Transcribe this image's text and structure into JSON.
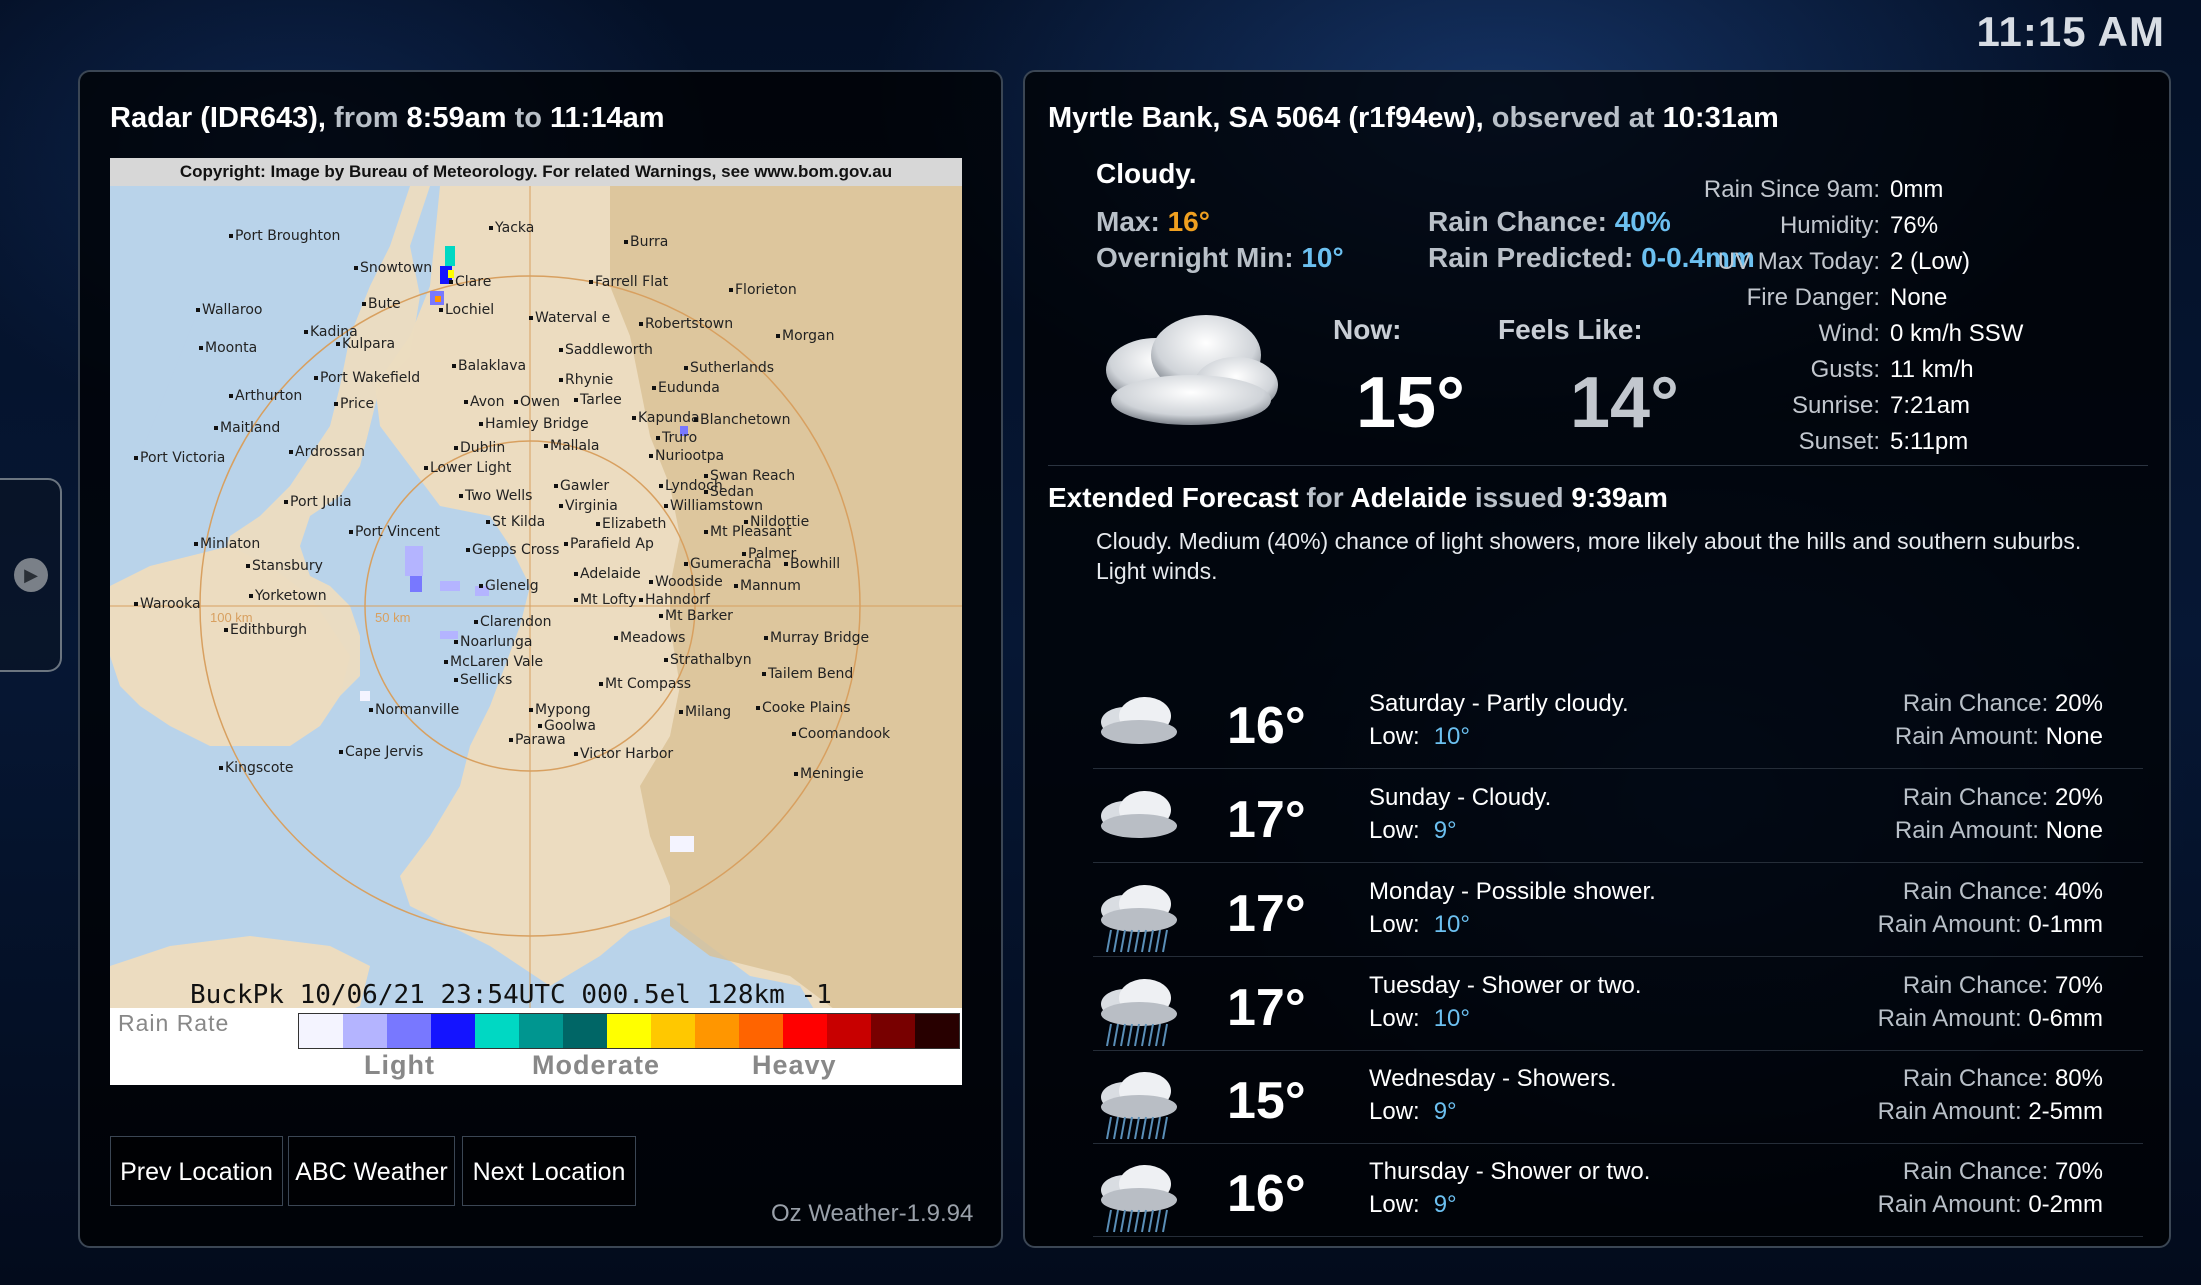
{
  "clock": "11:15 AM",
  "radar_panel": {
    "title_prefix": "Radar (IDR643),",
    "title_from": "from",
    "title_start": "8:59am",
    "title_to": "to",
    "title_end": "11:14am",
    "copyright": "Copyright: Image by Bureau of Meteorology. For related Warnings, see www.bom.gov.au",
    "info_line": "BuckPk  10/06/21 23:54UTC 000.5el 128km -1",
    "legend_title": "Rain Rate",
    "legend_light": "Light",
    "legend_moderate": "Moderate",
    "legend_heavy": "Heavy",
    "ring_labels": [
      "100 km",
      "50 km"
    ],
    "legend_colors": [
      "#f4f4ff",
      "#b4b4ff",
      "#7878ff",
      "#1414ff",
      "#00d8c3",
      "#009690",
      "#006666",
      "#ffff00",
      "#ffc800",
      "#ff9600",
      "#ff6400",
      "#ff0000",
      "#c80000",
      "#780000",
      "#280000"
    ],
    "towns": [
      "Port Broughton",
      "Yacka",
      "Burra",
      "Snowtown",
      "Clare",
      "Farrell Flat",
      "Florieton",
      "Bute",
      "Lochiel",
      "Wallaroo",
      "Kadina",
      "Waterval e",
      "Robertstown",
      "Morgan",
      "Moonta",
      "Kulpara",
      "Saddleworth",
      "Balaklava",
      "Sutherlands",
      "Port Wakefield",
      "Rhynie",
      "Eudunda",
      "Arthurton",
      "Price",
      "Avon",
      "Owen",
      "Tarlee",
      "Maitland",
      "Hamley Bridge",
      "Kapunda",
      "Blanchetown",
      "Dublin",
      "Mallala",
      "Truro",
      "Port Victoria",
      "Ardrossan",
      "Nuriootpa",
      "Lower Light",
      "Swan Reach",
      "Two Wells",
      "Gawler",
      "Lyndoch",
      "Sedan",
      "Port Julia",
      "Virginia",
      "Williamstown",
      "Nildottie",
      "St Kilda",
      "Elizabeth",
      "Mt Pleasant",
      "Minlaton",
      "Port Vincent",
      "Parafield Ap",
      "Palmer",
      "Stansbury",
      "Gepps Cross",
      "Gumeracha",
      "Bowhill",
      "Glenelg",
      "Adelaide",
      "Woodside",
      "Mannum",
      "Yorketown",
      "Mt Lofty",
      "Hahndorf",
      "Warooka",
      "Mt Barker",
      "Edithburgh",
      "Clarendon",
      "Meadows",
      "Murray Bridge",
      "Noarlunga",
      "Strathalbyn",
      "McLaren Vale",
      "Tailem Bend",
      "Sellicks",
      "Mt Compass",
      "Normanville",
      "Mypong",
      "Milang",
      "Cooke Plains",
      "Goolwa",
      "Coomandook",
      "Parawa",
      "Cape Jervis",
      "Victor Harbor",
      "Kingscote",
      "Meningie"
    ],
    "buttons": [
      "Prev Location",
      "ABC Weather",
      "Next Location"
    ],
    "version": "Oz Weather-1.9.94"
  },
  "obs_panel": {
    "location": "Myrtle Bank, SA 5064 (r1f94ew),",
    "observed_label": "observed at",
    "observed_time": "10:31am",
    "condition": "Cloudy.",
    "max_label": "Max:",
    "max_value": "16°",
    "min_label": "Overnight Min:",
    "min_value": "10°",
    "rain_chance_label": "Rain Chance:",
    "rain_chance_value": "40%",
    "rain_pred_label": "Rain Predicted:",
    "rain_pred_value": "0-0.4mm",
    "now_label": "Now:",
    "now_temp": "15°",
    "feels_label": "Feels Like:",
    "feels_temp": "14°",
    "details": [
      {
        "k": "Rain Since 9am:",
        "v": "0mm"
      },
      {
        "k": "Humidity:",
        "v": "76%"
      },
      {
        "k": "UV Max Today:",
        "v": "2 (Low)"
      },
      {
        "k": "Fire Danger:",
        "v": "None"
      },
      {
        "k": "Wind:",
        "v": "0 km/h SSW"
      },
      {
        "k": "Gusts:",
        "v": "11 km/h"
      },
      {
        "k": "Sunrise:",
        "v": "7:21am"
      },
      {
        "k": "Sunset:",
        "v": "5:11pm"
      }
    ]
  },
  "extended": {
    "title": "Extended Forecast",
    "for_label": "for",
    "city": "Adelaide",
    "issued_label": "issued",
    "issued_time": "9:39am",
    "description": "Cloudy. Medium (40%) chance of light showers, more likely about the hills and southern suburbs. Light winds.",
    "days": [
      {
        "icon": "partly-cloudy-icon",
        "temp": "16°",
        "day": "Saturday - Partly cloudy.",
        "low_label": "Low:",
        "low": "10°",
        "rc_label": "Rain Chance:",
        "rc": "20%",
        "ra_label": "Rain Amount:",
        "ra": "None"
      },
      {
        "icon": "cloudy-icon",
        "temp": "17°",
        "day": "Sunday - Cloudy.",
        "low_label": "Low:",
        "low": "9°",
        "rc_label": "Rain Chance:",
        "rc": "20%",
        "ra_label": "Rain Amount:",
        "ra": "None"
      },
      {
        "icon": "shower-icon",
        "temp": "17°",
        "day": "Monday - Possible shower.",
        "low_label": "Low:",
        "low": "10°",
        "rc_label": "Rain Chance:",
        "rc": "40%",
        "ra_label": "Rain Amount:",
        "ra": "0-1mm"
      },
      {
        "icon": "shower-icon",
        "temp": "17°",
        "day": "Tuesday - Shower or two.",
        "low_label": "Low:",
        "low": "10°",
        "rc_label": "Rain Chance:",
        "rc": "70%",
        "ra_label": "Rain Amount:",
        "ra": "0-6mm"
      },
      {
        "icon": "shower-icon",
        "temp": "15°",
        "day": "Wednesday - Showers.",
        "low_label": "Low:",
        "low": "9°",
        "rc_label": "Rain Chance:",
        "rc": "80%",
        "ra_label": "Rain Amount:",
        "ra": "2-5mm"
      },
      {
        "icon": "shower-icon",
        "temp": "16°",
        "day": "Thursday - Shower or two.",
        "low_label": "Low:",
        "low": "9°",
        "rc_label": "Rain Chance:",
        "rc": "70%",
        "ra_label": "Rain Amount:",
        "ra": "0-2mm"
      }
    ]
  }
}
